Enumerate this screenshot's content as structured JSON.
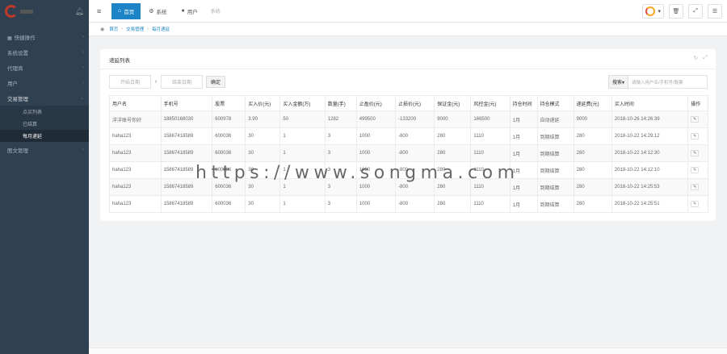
{
  "sidebar": {
    "items": [
      {
        "label": "快捷操作",
        "icon": "grid-icon"
      },
      {
        "label": "系统设置",
        "icon": ""
      },
      {
        "label": "代理商",
        "icon": ""
      },
      {
        "label": "用户",
        "icon": ""
      },
      {
        "label": "交易管理",
        "icon": ""
      },
      {
        "label": "图文管理",
        "icon": ""
      }
    ],
    "submenu": [
      "点买列表",
      "已结算",
      "每月递延"
    ]
  },
  "topbar": {
    "nav": [
      {
        "label": "首页",
        "icon": "home-icon",
        "active": true
      },
      {
        "label": "系统",
        "icon": "gear-icon",
        "active": false
      },
      {
        "label": "用户",
        "icon": "user-icon",
        "active": false
      }
    ],
    "extra": "系统"
  },
  "breadcrumb": [
    "首页",
    "交易管理",
    "每月递延"
  ],
  "card": {
    "title": "递延列表"
  },
  "filter": {
    "start_placeholder": "开始日期",
    "end_placeholder": "结束日期",
    "confirm_label": "确定",
    "search_select": "搜索▾",
    "search_placeholder": "请输入用户名/手机号/股票"
  },
  "table": {
    "headers": [
      "用户名",
      "手机号",
      "股票",
      "买入价(元)",
      "买入金额(万)",
      "数量(手)",
      "止盈价(元)",
      "止损价(元)",
      "保证金(元)",
      "风控金(元)",
      "持仓时间",
      "持仓模式",
      "递延费(元)",
      "买入时间",
      "操作"
    ],
    "rows": [
      [
        "洋洋账号你好",
        "18850168030",
        "600978",
        "3.90",
        "50",
        "1282",
        "499500",
        "-133200",
        "9000",
        "166500",
        "1月",
        "自动递延",
        "9000",
        "2018-10-26 14:26:39"
      ],
      [
        "haha123",
        "15867418589",
        "600036",
        "30",
        "1",
        "3",
        "1000",
        "-800",
        "280",
        "1110",
        "1月",
        "到期结算",
        "280",
        "2018-10-22 14:29:12"
      ],
      [
        "haha123",
        "15867418589",
        "600036",
        "30",
        "1",
        "3",
        "1000",
        "-800",
        "280",
        "1110",
        "1月",
        "到期结算",
        "280",
        "2018-10-22 14:12:30"
      ],
      [
        "haha123",
        "15867418589",
        "600036",
        "30",
        "1",
        "3",
        "1000",
        "-800",
        "280",
        "1110",
        "1月",
        "到期结算",
        "280",
        "2018-10-22 14:12:10"
      ],
      [
        "haha123",
        "15867418589",
        "600036",
        "30",
        "1",
        "3",
        "1000",
        "-800",
        "280",
        "1110",
        "1月",
        "到期结算",
        "280",
        "2018-10-22 14:25:53"
      ],
      [
        "haha123",
        "15867418589",
        "600036",
        "30",
        "1",
        "3",
        "1000",
        "-800",
        "280",
        "1110",
        "1月",
        "到期结算",
        "280",
        "2018-10-22 14:25:51"
      ]
    ]
  },
  "watermark": "https://www.songma.com"
}
